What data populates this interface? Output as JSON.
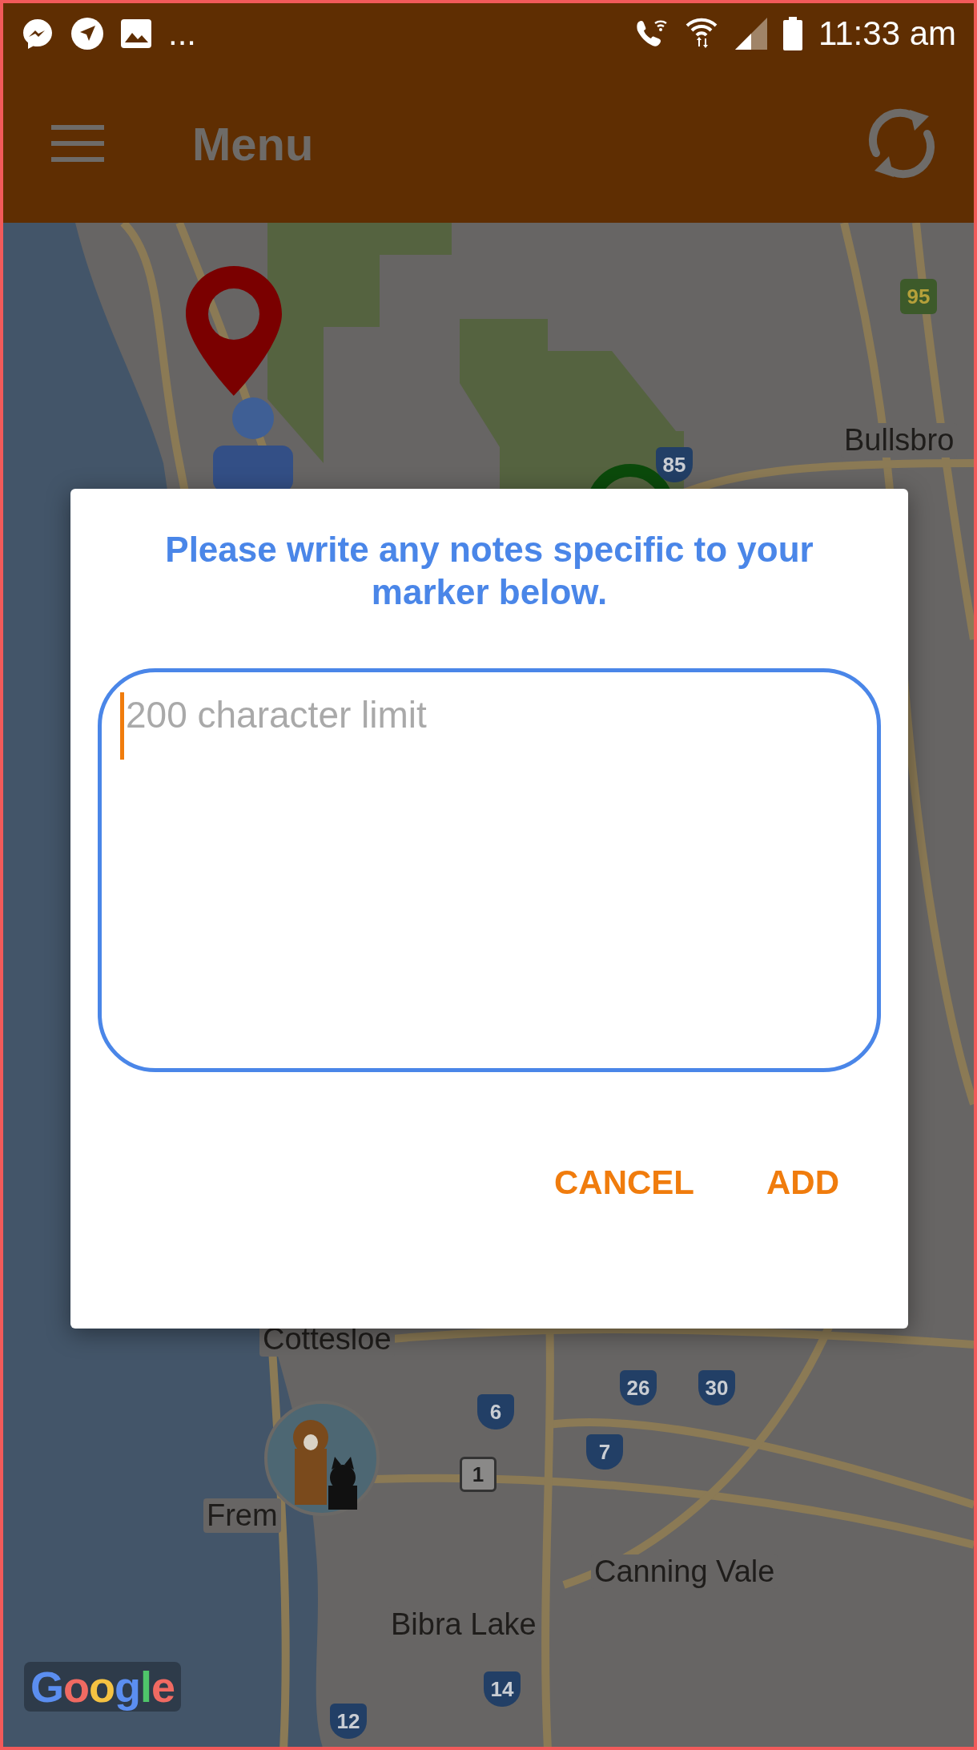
{
  "status_bar": {
    "overflow": "...",
    "time": "11:33 am"
  },
  "app_bar": {
    "title": "Menu"
  },
  "map": {
    "place_labels": [
      "Bullsbro",
      "Cottesloe",
      "Frem",
      "Canning Vale",
      "Bibra Lake"
    ],
    "route_shields": [
      {
        "text": "95",
        "kind": "state"
      },
      {
        "text": "85",
        "kind": "national"
      },
      {
        "text": "6",
        "kind": "national"
      },
      {
        "text": "26",
        "kind": "national"
      },
      {
        "text": "30",
        "kind": "national"
      },
      {
        "text": "1",
        "kind": "highway"
      },
      {
        "text": "7",
        "kind": "national"
      },
      {
        "text": "14",
        "kind": "national"
      },
      {
        "text": "12",
        "kind": "national"
      }
    ],
    "attribution": "Google"
  },
  "dialog": {
    "title": "Please write any notes specific to your marker below.",
    "notes_field": {
      "placeholder": "200 character limit"
    },
    "buttons": [
      "CANCEL",
      "ADD"
    ]
  }
}
